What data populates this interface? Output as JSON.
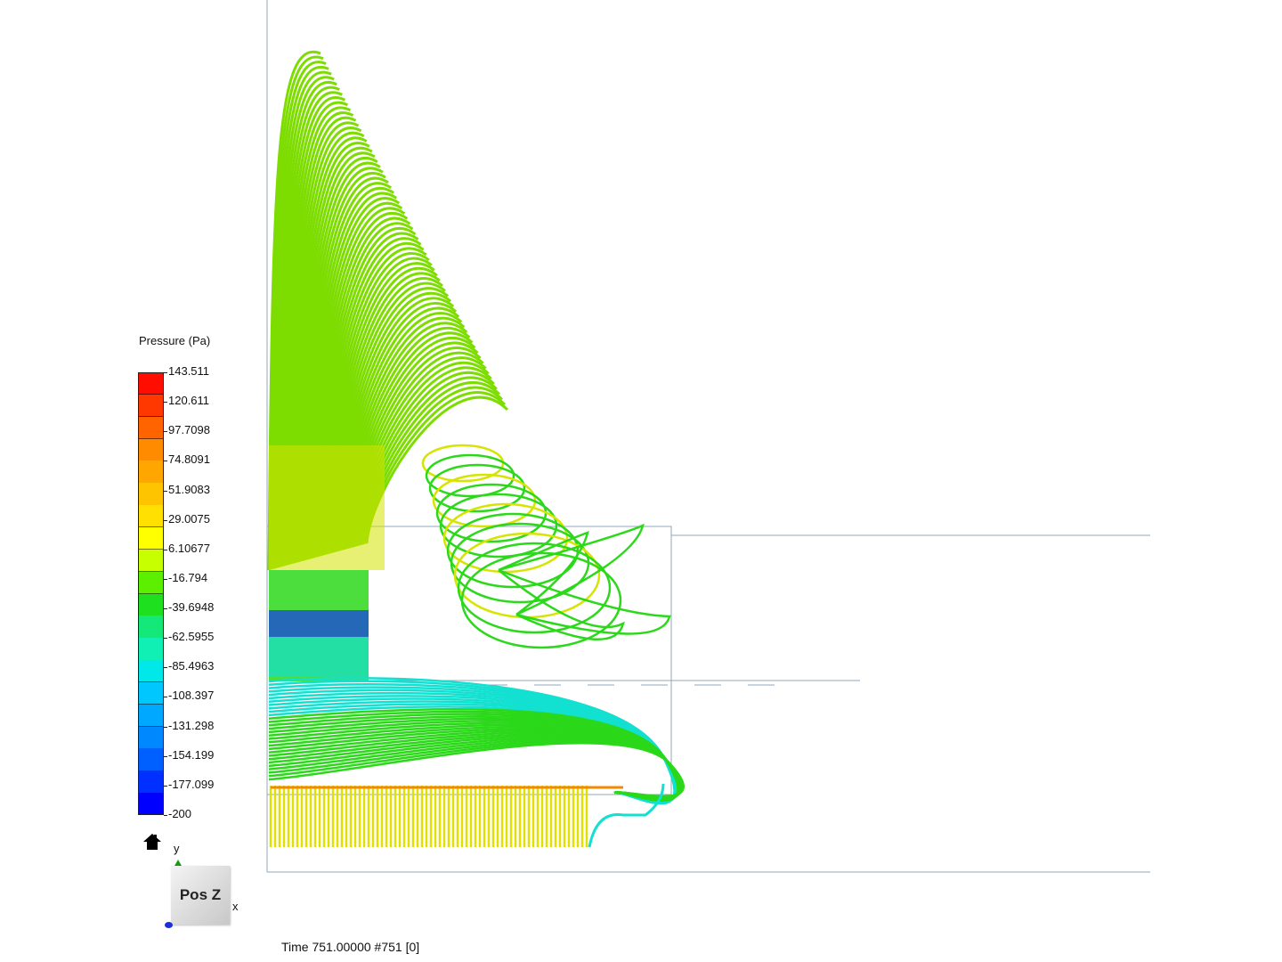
{
  "legend": {
    "title": "Pressure (Pa)",
    "ticks": [
      "143.511",
      "120.611",
      "97.7098",
      "74.8091",
      "51.9083",
      "29.0075",
      "6.10677",
      "-16.794",
      "-39.6948",
      "-62.5955",
      "-85.4963",
      "-108.397",
      "-131.298",
      "-154.199",
      "-177.099",
      "-200"
    ],
    "colors": [
      "#ff0d00",
      "#ff3800",
      "#ff6400",
      "#ff8c00",
      "#ffa600",
      "#ffc400",
      "#ffe000",
      "#ffff00",
      "#c8ff00",
      "#5cf000",
      "#1fe01f",
      "#14e878",
      "#10f0b4",
      "#00e8e8",
      "#00c8ff",
      "#00a8ff",
      "#0088ff",
      "#0060ff",
      "#0030ff",
      "#0000ff"
    ]
  },
  "orientation": {
    "view_label": "Pos Z",
    "axis_y": "y",
    "axis_x": "x",
    "axis_z": "z",
    "home_icon": "home-icon"
  },
  "status": {
    "time_label": "Time 751.00000  #751 [0]"
  },
  "scene": {
    "quantity": "Pressure",
    "value_range": [
      -200,
      143.511
    ],
    "streamline_colors": {
      "upper_fan": "#7ddc00",
      "mid_yellow": "#d6e400",
      "lower_green": "#2bd81a",
      "cyan_band": "#12e0d0",
      "bottom_yellow": "#e2e000",
      "low_blue": "#1840e0"
    }
  }
}
